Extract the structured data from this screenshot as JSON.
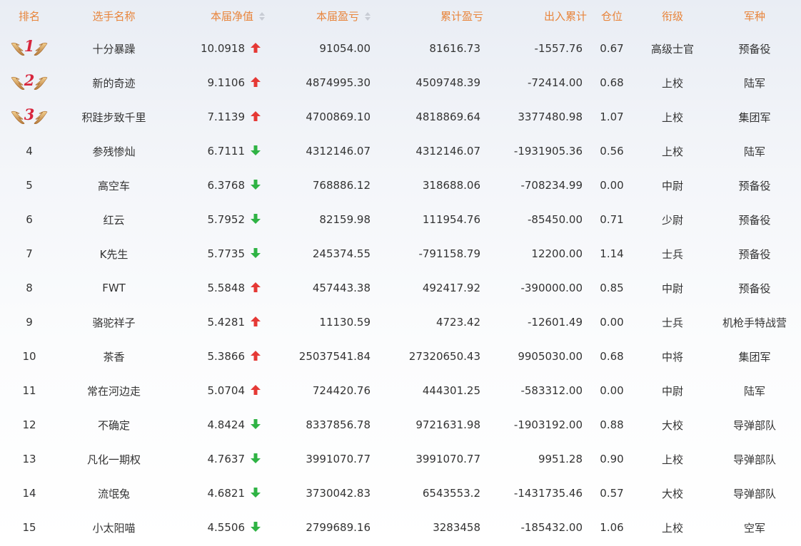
{
  "headers": {
    "rank": "排名",
    "name": "选手名称",
    "net_value": "本届净值",
    "profit": "本届盈亏",
    "total_profit": "累计盈亏",
    "inout": "出入累计",
    "position": "仓位",
    "title": "衔级",
    "branch": "军种"
  },
  "colors": {
    "header_text": "#e8843a",
    "up_arrow": "#e53935",
    "down_arrow": "#2fb344",
    "medal_number": "#d7263d"
  },
  "rows": [
    {
      "rank": "1",
      "medal": true,
      "name": "十分暴躁",
      "net": "10.0918",
      "trend": "up",
      "profit": "91054.00",
      "total": "81616.73",
      "inout": "-1557.76",
      "pos": "0.67",
      "title": "高级士官",
      "branch": "预备役"
    },
    {
      "rank": "2",
      "medal": true,
      "name": "新的奇迹",
      "net": "9.1106",
      "trend": "up",
      "profit": "4874995.30",
      "total": "4509748.39",
      "inout": "-72414.00",
      "pos": "0.68",
      "title": "上校",
      "branch": "陆军"
    },
    {
      "rank": "3",
      "medal": true,
      "name": "积跬步致千里",
      "net": "7.1139",
      "trend": "up",
      "profit": "4700869.10",
      "total": "4818869.64",
      "inout": "3377480.98",
      "pos": "1.07",
      "title": "上校",
      "branch": "集团军"
    },
    {
      "rank": "4",
      "medal": false,
      "name": "参残惨灿",
      "net": "6.7111",
      "trend": "down",
      "profit": "4312146.07",
      "total": "4312146.07",
      "inout": "-1931905.36",
      "pos": "0.56",
      "title": "上校",
      "branch": "陆军"
    },
    {
      "rank": "5",
      "medal": false,
      "name": "高空车",
      "net": "6.3768",
      "trend": "down",
      "profit": "768886.12",
      "total": "318688.06",
      "inout": "-708234.99",
      "pos": "0.00",
      "title": "中尉",
      "branch": "预备役"
    },
    {
      "rank": "6",
      "medal": false,
      "name": "红云",
      "net": "5.7952",
      "trend": "down",
      "profit": "82159.98",
      "total": "111954.76",
      "inout": "-85450.00",
      "pos": "0.71",
      "title": "少尉",
      "branch": "预备役"
    },
    {
      "rank": "7",
      "medal": false,
      "name": "K先生",
      "net": "5.7735",
      "trend": "down",
      "profit": "245374.55",
      "total": "-791158.79",
      "inout": "12200.00",
      "pos": "1.14",
      "title": "士兵",
      "branch": "预备役"
    },
    {
      "rank": "8",
      "medal": false,
      "name": "FWT",
      "net": "5.5848",
      "trend": "up",
      "profit": "457443.38",
      "total": "492417.92",
      "inout": "-390000.00",
      "pos": "0.85",
      "title": "中尉",
      "branch": "预备役"
    },
    {
      "rank": "9",
      "medal": false,
      "name": "骆驼祥子",
      "net": "5.4281",
      "trend": "up",
      "profit": "11130.59",
      "total": "4723.42",
      "inout": "-12601.49",
      "pos": "0.00",
      "title": "士兵",
      "branch": "机枪手特战营"
    },
    {
      "rank": "10",
      "medal": false,
      "name": "茶香",
      "net": "5.3866",
      "trend": "up",
      "profit": "25037541.84",
      "total": "27320650.43",
      "inout": "9905030.00",
      "pos": "0.68",
      "title": "中将",
      "branch": "集团军"
    },
    {
      "rank": "11",
      "medal": false,
      "name": "常在河边走",
      "net": "5.0704",
      "trend": "up",
      "profit": "724420.76",
      "total": "444301.25",
      "inout": "-583312.00",
      "pos": "0.00",
      "title": "中尉",
      "branch": "陆军"
    },
    {
      "rank": "12",
      "medal": false,
      "name": "不确定",
      "net": "4.8424",
      "trend": "down",
      "profit": "8337856.78",
      "total": "9721631.98",
      "inout": "-1903192.00",
      "pos": "0.88",
      "title": "大校",
      "branch": "导弹部队"
    },
    {
      "rank": "13",
      "medal": false,
      "name": "凡化一期权",
      "net": "4.7637",
      "trend": "down",
      "profit": "3991070.77",
      "total": "3991070.77",
      "inout": "9951.28",
      "pos": "0.90",
      "title": "上校",
      "branch": "导弹部队"
    },
    {
      "rank": "14",
      "medal": false,
      "name": "流氓兔",
      "net": "4.6821",
      "trend": "down",
      "profit": "3730042.83",
      "total": "6543553.2",
      "inout": "-1431735.46",
      "pos": "0.57",
      "title": "大校",
      "branch": "导弹部队"
    },
    {
      "rank": "15",
      "medal": false,
      "name": "小太阳喵",
      "net": "4.5506",
      "trend": "down",
      "profit": "2799689.16",
      "total": "3283458",
      "inout": "-185432.00",
      "pos": "1.06",
      "title": "上校",
      "branch": "空军"
    }
  ]
}
